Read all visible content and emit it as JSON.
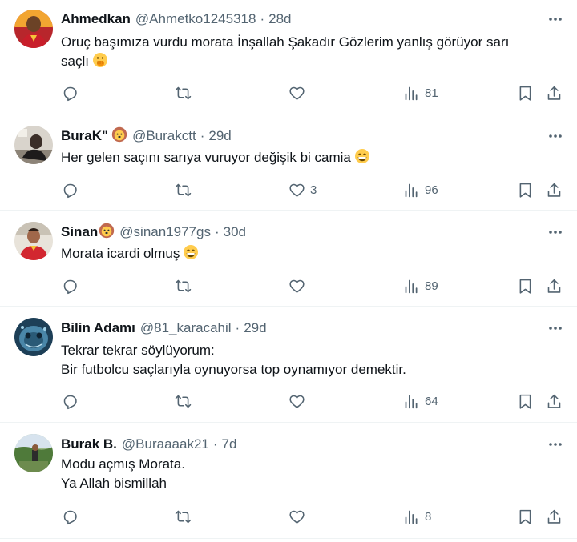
{
  "tweets": [
    {
      "name": "Ahmedkan",
      "name_emoji": "",
      "handle": "@Ahmetko1245318",
      "time": "28d",
      "lines": [
        "Oruç başımıza vurdu morata İnşallah Şakadır Gözlerim yanlış görüyor sarı",
        "saçlı"
      ],
      "trailing_emoji": "face-with-hand-over-mouth",
      "likes": "",
      "views": "81"
    },
    {
      "name": "BuraK\"",
      "name_emoji": "lion-face",
      "handle": "@Burakctt",
      "time": "29d",
      "lines": [
        "Her gelen saçını sarıya vuruyor değişik bi camia"
      ],
      "trailing_emoji": "grinning-face",
      "likes": "3",
      "views": "96"
    },
    {
      "name": "Sinan",
      "name_emoji": "lion-face",
      "handle": "@sinan1977gs",
      "time": "30d",
      "lines": [
        "Morata icardi olmuş"
      ],
      "trailing_emoji": "grinning-face",
      "likes": "",
      "views": "89"
    },
    {
      "name": "Bilin Adamı",
      "name_emoji": "",
      "handle": "@81_karacahil",
      "time": "29d",
      "lines": [
        "Tekrar tekrar söylüyorum:",
        "Bir futbolcu saçlarıyla oynuyorsa top oynamıyor demektir."
      ],
      "trailing_emoji": "",
      "likes": "",
      "views": "64"
    },
    {
      "name": "Burak B.",
      "name_emoji": "",
      "handle": "@Buraaaak21",
      "time": "7d",
      "lines": [
        "Modu açmış Morata.",
        "Ya Allah bismillah"
      ],
      "trailing_emoji": "",
      "likes": "",
      "views": "8"
    }
  ],
  "separator": "·",
  "colors": {
    "text": "#0f1419",
    "muted": "#536471",
    "divider": "#eff3f4"
  },
  "icons": {
    "reply": "reply-icon",
    "retweet": "retweet-icon",
    "like": "heart-icon",
    "views": "views-icon",
    "bookmark": "bookmark-icon",
    "share": "share-icon",
    "more": "more-icon"
  }
}
